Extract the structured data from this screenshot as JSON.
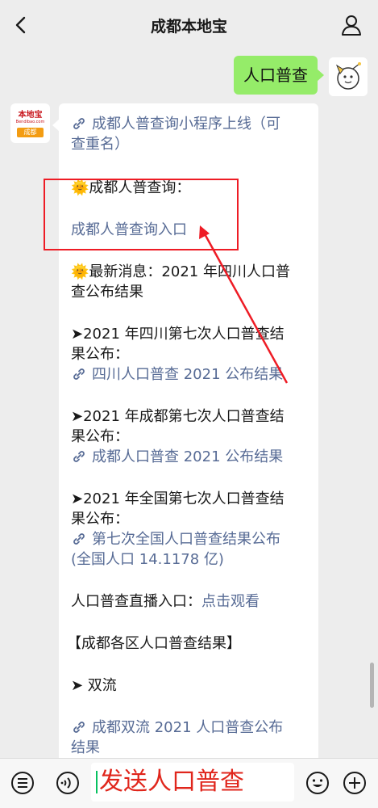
{
  "header": {
    "title": "成都本地宝",
    "back_icon": "chevron-left-icon",
    "profile_icon": "person-icon"
  },
  "user_message": {
    "text": "人口普查"
  },
  "bot_avatar": {
    "logo_text": "本地宝",
    "logo_url": "Bendibao.com",
    "city": "成都"
  },
  "bot_message": {
    "link1_line1": "成都人普查询小程序上线（可",
    "link1_line2": "查重名）",
    "sun_query_label": "🌞成都人普查询：",
    "query_link": "成都人普查询入口",
    "news_line1": "🌞最新消息：2021 年四川人口普",
    "news_line2": "查公布结果",
    "sichuan_line1": "➤2021 年四川第七次人口普查结",
    "sichuan_line2": "果公布：",
    "sichuan_link": "四川人口普查 2021 公布结果",
    "chengdu_line1": "➤2021 年成都第七次人口普查结",
    "chengdu_line2": "果公布：",
    "chengdu_link": "成都人口普查 2021 公布结果",
    "national_line1": "➤2021 年全国第七次人口普查结",
    "national_line2": "果公布：",
    "national_link_line1": "第七次全国人口普查结果公布",
    "national_link_line2": "(全国人口 14.1178 亿)",
    "live_label": "人口普查直播入口：",
    "live_link": "点击观看",
    "districts_header": "【成都各区人口普查结果】",
    "shuangliu_label": "➤ 双流",
    "shuangliu_link_line1": "成都双流 2021 人口普查公布",
    "shuangliu_link_line2": "结果"
  },
  "colors": {
    "link": "#576b95",
    "bubble_green": "#95ec69",
    "annotation_red": "#ee1c25"
  },
  "bottom_bar": {
    "menu_icon": "list-menu-icon",
    "voice_icon": "voice-icon",
    "input_value": "发送人口普查",
    "emoji_icon": "smiley-icon",
    "plus_icon": "plus-circle-icon"
  }
}
